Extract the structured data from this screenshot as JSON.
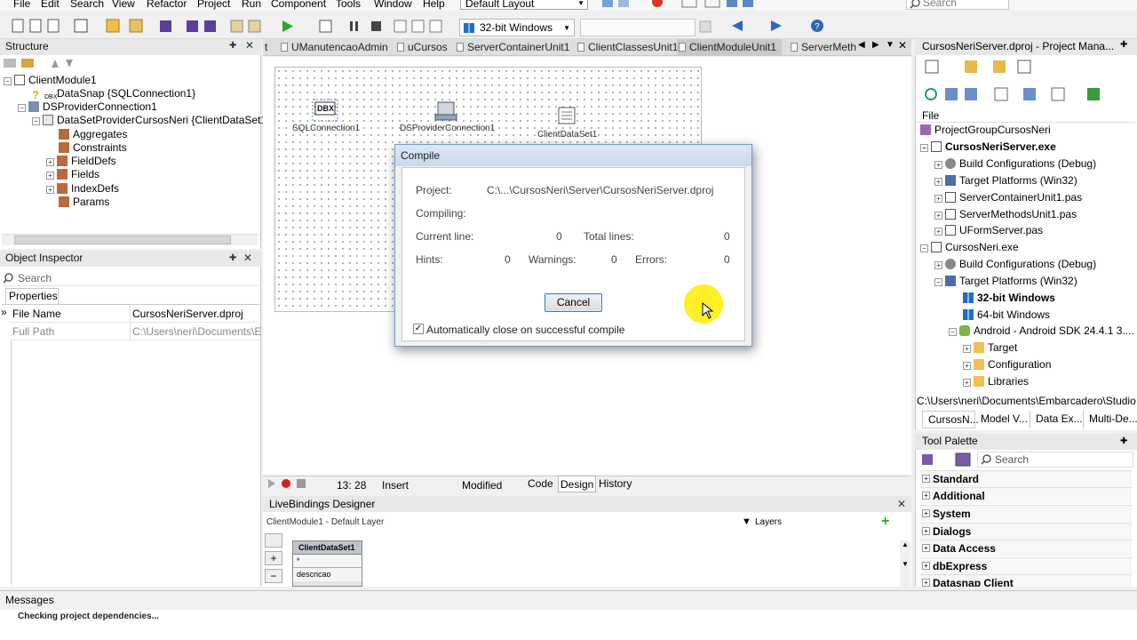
{
  "menu": [
    "File",
    "Edit",
    "Search",
    "View",
    "Refactor",
    "Project",
    "Run",
    "Component",
    "Tools",
    "Window",
    "Help"
  ],
  "layout_combo": "Default Layout",
  "top_search_placeholder": "Search",
  "platform_combo": "32-bit Windows",
  "structure": {
    "title": "Structure",
    "items": [
      {
        "label": "ClientModule1"
      },
      {
        "label": "DataSnap {SQLConnection1}"
      },
      {
        "label": "DSProviderConnection1"
      },
      {
        "label": "DataSetProviderCursosNeri {ClientDataSet1"
      },
      {
        "label": "Aggregates"
      },
      {
        "label": "Constraints"
      },
      {
        "label": "FieldDefs"
      },
      {
        "label": "Fields"
      },
      {
        "label": "IndexDefs"
      },
      {
        "label": "Params"
      }
    ]
  },
  "object_inspector": {
    "title": "Object Inspector",
    "search_placeholder": "Search",
    "tab": "Properties",
    "rows": [
      {
        "name": "File Name",
        "value": "CursosNeriServer.dproj"
      },
      {
        "name": "Full Path",
        "value": "C:\\Users\\neri\\Documents\\E"
      }
    ]
  },
  "editor_tabs": [
    {
      "label": "t"
    },
    {
      "label": "UManutencaoAdmin"
    },
    {
      "label": "uCursos"
    },
    {
      "label": "ServerContainerUnit1"
    },
    {
      "label": "ClientClassesUnit1"
    },
    {
      "label": "ClientModuleUnit1"
    },
    {
      "label": "ServerMeth"
    }
  ],
  "designer": {
    "components": [
      {
        "label": "SQLConnection1",
        "badge": "DBX"
      },
      {
        "label": "DSProviderConnection1"
      },
      {
        "label": "ClientDataSet1"
      }
    ]
  },
  "compile_dialog": {
    "title": "Compile",
    "project_label": "Project:",
    "project_value": "C:\\...\\CursosNeri\\Server\\CursosNeriServer.dproj",
    "compiling_label": "Compiling:",
    "current_line_label": "Current line:",
    "current_line_value": "0",
    "total_lines_label": "Total lines:",
    "total_lines_value": "0",
    "hints_label": "Hints:",
    "hints_value": "0",
    "warnings_label": "Warnings:",
    "warnings_value": "0",
    "errors_label": "Errors:",
    "errors_value": "0",
    "cancel_label": "Cancel",
    "auto_close_label": "Automatically close on successful compile"
  },
  "status_bar": {
    "position": "13:  28",
    "mode": "Insert",
    "state": "Modified",
    "view_tabs": [
      "Code",
      "Design",
      "History"
    ]
  },
  "livebindings": {
    "title": "LiveBindings Designer",
    "layer_info": "ClientModule1  - Default Layer",
    "layers_label": "Layers",
    "node_title": "ClientDataSet1",
    "node_fields": [
      "*",
      "descricao"
    ]
  },
  "project_manager": {
    "title": "CursosNeriServer.dproj - Project Mana...",
    "file_label": "File",
    "items": [
      {
        "label": "ProjectGroupCursosNeri",
        "bold": false
      },
      {
        "label": "CursosNeriServer.exe",
        "bold": true
      },
      {
        "label": "Build Configurations (Debug)",
        "bold": false
      },
      {
        "label": "Target Platforms (Win32)",
        "bold": false
      },
      {
        "label": "ServerContainerUnit1.pas",
        "bold": false
      },
      {
        "label": "ServerMethodsUnit1.pas",
        "bold": false
      },
      {
        "label": "UFormServer.pas",
        "bold": false
      },
      {
        "label": "CursosNeri.exe",
        "bold": false
      },
      {
        "label": "Build Configurations (Debug)",
        "bold": false
      },
      {
        "label": "Target Platforms (Win32)",
        "bold": false
      },
      {
        "label": "32-bit Windows",
        "bold": true
      },
      {
        "label": "64-bit Windows",
        "bold": false
      },
      {
        "label": "Android - Android SDK 24.4.1 3....",
        "bold": false
      },
      {
        "label": "Target",
        "bold": false
      },
      {
        "label": "Configuration",
        "bold": false
      },
      {
        "label": "Libraries",
        "bold": false
      }
    ],
    "path": "C:\\Users\\neri\\Documents\\Embarcadero\\Studio",
    "tabs": [
      "CursosN...",
      "Model V...",
      "Data Ex...",
      "Multi-De..."
    ]
  },
  "tool_palette": {
    "title": "Tool Palette",
    "search_placeholder": "Search",
    "categories": [
      "Standard",
      "Additional",
      "System",
      "Dialogs",
      "Data Access",
      "dbExpress",
      "Datasnap Client"
    ]
  },
  "messages": {
    "title": "Messages",
    "text": "Checking project dependencies..."
  },
  "colors": {
    "accent": "#1e6ec8",
    "highlight": "#ffec00",
    "play": "#2aa82a"
  }
}
